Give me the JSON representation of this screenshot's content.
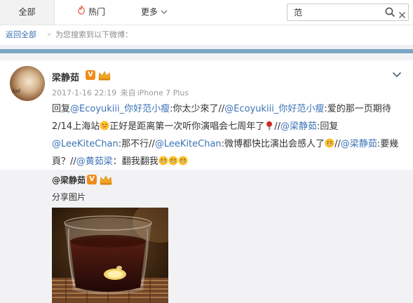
{
  "nav": {
    "tabs": [
      {
        "label": "全部"
      },
      {
        "label": "热门"
      },
      {
        "label": "更多"
      }
    ],
    "search": {
      "value": "范"
    }
  },
  "breadcrumb": {
    "back_label": "返回全部",
    "separator": "»",
    "note": "为您搜索到以下微博："
  },
  "post": {
    "author": "梁静茹",
    "verified_badge": "V",
    "meta": {
      "date": "2017-1-16 22:19",
      "source_prefix": "来自",
      "source": "iPhone 7 Plus"
    },
    "text_parts": [
      "回复",
      "@Ecoyukiii_你好范小瘦",
      ":你太少來了//",
      "@Ecoyukiii_你好范小瘦",
      ":爱的那一页期待2/14上海站",
      "正好是距离第一次听你演唱会七周年了",
      "//",
      "@梁静茹",
      ":回复",
      "@LeeKiteChan",
      ":那不行//",
      "@LeeKiteChan",
      ":微博都快比演出会感人了",
      "//",
      "@梁静茹",
      ":要幾頁？//",
      "@黄茹梁",
      "：翻我翻我"
    ],
    "emoji_names": [
      "grin-emoji",
      "rose-emoji",
      "laugh-emoji"
    ],
    "avatar_scrawl": "lad",
    "colors": {
      "mention": "#3b73b5",
      "badge": "#f08c1a",
      "accent_bar": "#7aa6c0"
    }
  },
  "repost": {
    "author": "@梁静茹",
    "verified_badge": "V",
    "text": "分享图片"
  }
}
